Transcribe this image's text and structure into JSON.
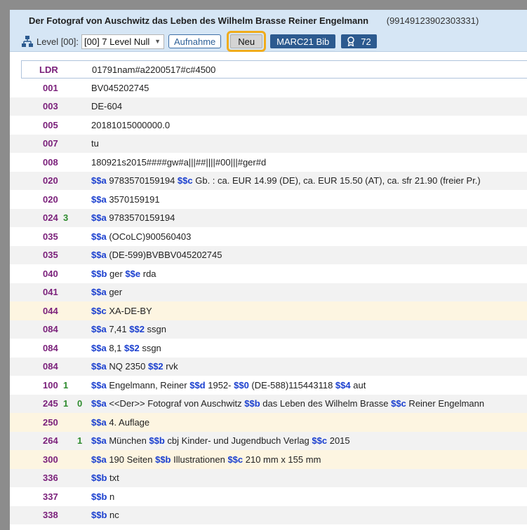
{
  "header": {
    "title": "Der Fotograf von Auschwitz das Leben des Wilhelm Brasse Reiner Engelmann",
    "record_id": "(99149123902303331)",
    "level_label": "Level [00]:",
    "level_value": "[00] 7 Level Null",
    "btn_aufnahme": "Aufnahme",
    "btn_neu": "Neu",
    "btn_marc": "MARC21 Bib",
    "badge_count": "72"
  },
  "colors": {
    "header_bg": "#d6e6f5",
    "tag_purple": "#7a1f7a",
    "indicator_green": "#2e8b2e",
    "subfield_blue": "#1a3fcf",
    "highlight_row": "#fdf5e1",
    "focus_outline": "#f0ac1c",
    "button_blue": "#2c5a8f"
  },
  "icons": {
    "hierarchy": "hierarchy-icon",
    "badge": "award-badge-icon",
    "caret": "chevron-down-icon"
  },
  "fields": [
    {
      "tag": "LDR",
      "ind1": "",
      "ind2": "",
      "style": "ldr",
      "parts": [
        {
          "t": "text",
          "v": "01791nam#a2200517#c#4500"
        }
      ]
    },
    {
      "tag": "001",
      "ind1": "",
      "ind2": "",
      "style": "",
      "parts": [
        {
          "t": "text",
          "v": "BV045202745"
        }
      ]
    },
    {
      "tag": "003",
      "ind1": "",
      "ind2": "",
      "style": "alt",
      "parts": [
        {
          "t": "text",
          "v": "DE-604"
        }
      ]
    },
    {
      "tag": "005",
      "ind1": "",
      "ind2": "",
      "style": "",
      "parts": [
        {
          "t": "text",
          "v": "20181015000000.0"
        }
      ]
    },
    {
      "tag": "007",
      "ind1": "",
      "ind2": "",
      "style": "alt",
      "parts": [
        {
          "t": "text",
          "v": "tu"
        }
      ]
    },
    {
      "tag": "008",
      "ind1": "",
      "ind2": "",
      "style": "",
      "parts": [
        {
          "t": "text",
          "v": "180921s2015####gw#a|||##||||#00|||#ger#d"
        }
      ]
    },
    {
      "tag": "020",
      "ind1": "",
      "ind2": "",
      "style": "alt",
      "parts": [
        {
          "t": "sf",
          "v": "$$a"
        },
        {
          "t": "text",
          "v": " 9783570159194 "
        },
        {
          "t": "sf",
          "v": "$$c"
        },
        {
          "t": "text",
          "v": " Gb. : ca. EUR 14.99 (DE), ca. EUR 15.50 (AT), ca. sfr 21.90 (freier Pr.)"
        }
      ]
    },
    {
      "tag": "020",
      "ind1": "",
      "ind2": "",
      "style": "",
      "parts": [
        {
          "t": "sf",
          "v": "$$a"
        },
        {
          "t": "text",
          "v": " 3570159191"
        }
      ]
    },
    {
      "tag": "024",
      "ind1": "3",
      "ind2": "",
      "style": "alt",
      "parts": [
        {
          "t": "sf",
          "v": "$$a"
        },
        {
          "t": "text",
          "v": " 9783570159194"
        }
      ]
    },
    {
      "tag": "035",
      "ind1": "",
      "ind2": "",
      "style": "",
      "parts": [
        {
          "t": "sf",
          "v": "$$a"
        },
        {
          "t": "text",
          "v": " (OCoLC)900560403"
        }
      ]
    },
    {
      "tag": "035",
      "ind1": "",
      "ind2": "",
      "style": "alt",
      "parts": [
        {
          "t": "sf",
          "v": "$$a"
        },
        {
          "t": "text",
          "v": " (DE-599)BVBBV045202745"
        }
      ]
    },
    {
      "tag": "040",
      "ind1": "",
      "ind2": "",
      "style": "",
      "parts": [
        {
          "t": "sf",
          "v": "$$b"
        },
        {
          "t": "text",
          "v": " ger "
        },
        {
          "t": "sf",
          "v": "$$e"
        },
        {
          "t": "text",
          "v": " rda"
        }
      ]
    },
    {
      "tag": "041",
      "ind1": "",
      "ind2": "",
      "style": "alt",
      "parts": [
        {
          "t": "sf",
          "v": "$$a"
        },
        {
          "t": "text",
          "v": " ger"
        }
      ]
    },
    {
      "tag": "044",
      "ind1": "",
      "ind2": "",
      "style": "hl",
      "parts": [
        {
          "t": "sf",
          "v": "$$c"
        },
        {
          "t": "text",
          "v": " XA-DE-BY"
        }
      ]
    },
    {
      "tag": "084",
      "ind1": "",
      "ind2": "",
      "style": "alt",
      "parts": [
        {
          "t": "sf",
          "v": "$$a"
        },
        {
          "t": "text",
          "v": " 7,41 "
        },
        {
          "t": "sf",
          "v": "$$2"
        },
        {
          "t": "text",
          "v": " ssgn"
        }
      ]
    },
    {
      "tag": "084",
      "ind1": "",
      "ind2": "",
      "style": "",
      "parts": [
        {
          "t": "sf",
          "v": "$$a"
        },
        {
          "t": "text",
          "v": " 8,1 "
        },
        {
          "t": "sf",
          "v": "$$2"
        },
        {
          "t": "text",
          "v": " ssgn"
        }
      ]
    },
    {
      "tag": "084",
      "ind1": "",
      "ind2": "",
      "style": "alt",
      "parts": [
        {
          "t": "sf",
          "v": "$$a"
        },
        {
          "t": "text",
          "v": " NQ 2350 "
        },
        {
          "t": "sf",
          "v": "$$2"
        },
        {
          "t": "text",
          "v": " rvk"
        }
      ]
    },
    {
      "tag": "100",
      "ind1": "1",
      "ind2": "",
      "style": "",
      "parts": [
        {
          "t": "sf",
          "v": "$$a"
        },
        {
          "t": "text",
          "v": " Engelmann, Reiner "
        },
        {
          "t": "sf",
          "v": "$$d"
        },
        {
          "t": "text",
          "v": " 1952- "
        },
        {
          "t": "sf",
          "v": "$$0"
        },
        {
          "t": "text",
          "v": " (DE-588)115443118 "
        },
        {
          "t": "sf",
          "v": "$$4"
        },
        {
          "t": "text",
          "v": " aut"
        }
      ]
    },
    {
      "tag": "245",
      "ind1": "1",
      "ind2": "0",
      "style": "alt",
      "parts": [
        {
          "t": "sf",
          "v": "$$a"
        },
        {
          "t": "text",
          "v": " <<Der>> Fotograf von Auschwitz "
        },
        {
          "t": "sf",
          "v": "$$b"
        },
        {
          "t": "text",
          "v": " das Leben des Wilhelm Brasse "
        },
        {
          "t": "sf",
          "v": "$$c"
        },
        {
          "t": "text",
          "v": " Reiner Engelmann"
        }
      ]
    },
    {
      "tag": "250",
      "ind1": "",
      "ind2": "",
      "style": "hl",
      "parts": [
        {
          "t": "sf",
          "v": "$$a"
        },
        {
          "t": "text",
          "v": " 4. Auflage"
        }
      ]
    },
    {
      "tag": "264",
      "ind1": "",
      "ind2": "1",
      "style": "alt",
      "parts": [
        {
          "t": "sf",
          "v": "$$a"
        },
        {
          "t": "text",
          "v": " München "
        },
        {
          "t": "sf",
          "v": "$$b"
        },
        {
          "t": "text",
          "v": " cbj Kinder- und Jugendbuch Verlag "
        },
        {
          "t": "sf",
          "v": "$$c"
        },
        {
          "t": "text",
          "v": " 2015"
        }
      ]
    },
    {
      "tag": "300",
      "ind1": "",
      "ind2": "",
      "style": "hl",
      "parts": [
        {
          "t": "sf",
          "v": "$$a"
        },
        {
          "t": "text",
          "v": " 190 Seiten "
        },
        {
          "t": "sf",
          "v": "$$b"
        },
        {
          "t": "text",
          "v": " Illustrationen "
        },
        {
          "t": "sf",
          "v": "$$c"
        },
        {
          "t": "text",
          "v": " 210 mm x 155 mm"
        }
      ]
    },
    {
      "tag": "336",
      "ind1": "",
      "ind2": "",
      "style": "alt",
      "parts": [
        {
          "t": "sf",
          "v": "$$b"
        },
        {
          "t": "text",
          "v": " txt"
        }
      ]
    },
    {
      "tag": "337",
      "ind1": "",
      "ind2": "",
      "style": "",
      "parts": [
        {
          "t": "sf",
          "v": "$$b"
        },
        {
          "t": "text",
          "v": " n"
        }
      ]
    },
    {
      "tag": "338",
      "ind1": "",
      "ind2": "",
      "style": "alt",
      "parts": [
        {
          "t": "sf",
          "v": "$$b"
        },
        {
          "t": "text",
          "v": " nc"
        }
      ]
    }
  ]
}
